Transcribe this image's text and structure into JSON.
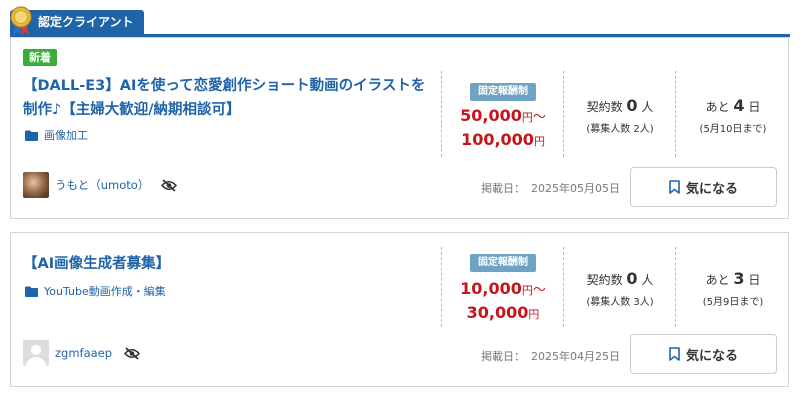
{
  "section": {
    "title": "認定クライアント"
  },
  "colors": {
    "accent": "#1f64a8",
    "new_badge": "#3aac3a",
    "price": "#c4161c",
    "fixed_label": "#6fa3c3"
  },
  "jobs": [
    {
      "badge": "新着",
      "title": "【DALL-E3】AIを使って恋愛創作ショート動画のイラストを制作♪【主婦大歓迎/納期相談可】",
      "category": "画像加工",
      "price_label": "固定報酬制",
      "price_min": "50,000",
      "price_max": "100,000",
      "yen": "円",
      "tilde": "～",
      "contract_label": "契約数",
      "contract_count": "0",
      "contract_unit": "人",
      "recruit_text": "(募集人数 2人)",
      "days_prefix": "あと",
      "days_left": "4",
      "days_unit": "日",
      "deadline_text": "(5月10日まで)",
      "client_name": "うもと（umoto）",
      "posted_label": "掲載日：",
      "posted_date": "2025年05月05日",
      "watch_label": "気になる"
    },
    {
      "badge": "",
      "title": "【AI画像生成者募集】",
      "category": "YouTube動画作成・編集",
      "price_label": "固定報酬制",
      "price_min": "10,000",
      "price_max": "30,000",
      "yen": "円",
      "tilde": "～",
      "contract_label": "契約数",
      "contract_count": "0",
      "contract_unit": "人",
      "recruit_text": "(募集人数 3人)",
      "days_prefix": "あと",
      "days_left": "3",
      "days_unit": "日",
      "deadline_text": "(5月9日まで)",
      "client_name": "zgmfaaep",
      "posted_label": "掲載日：",
      "posted_date": "2025年04月25日",
      "watch_label": "気になる"
    }
  ]
}
